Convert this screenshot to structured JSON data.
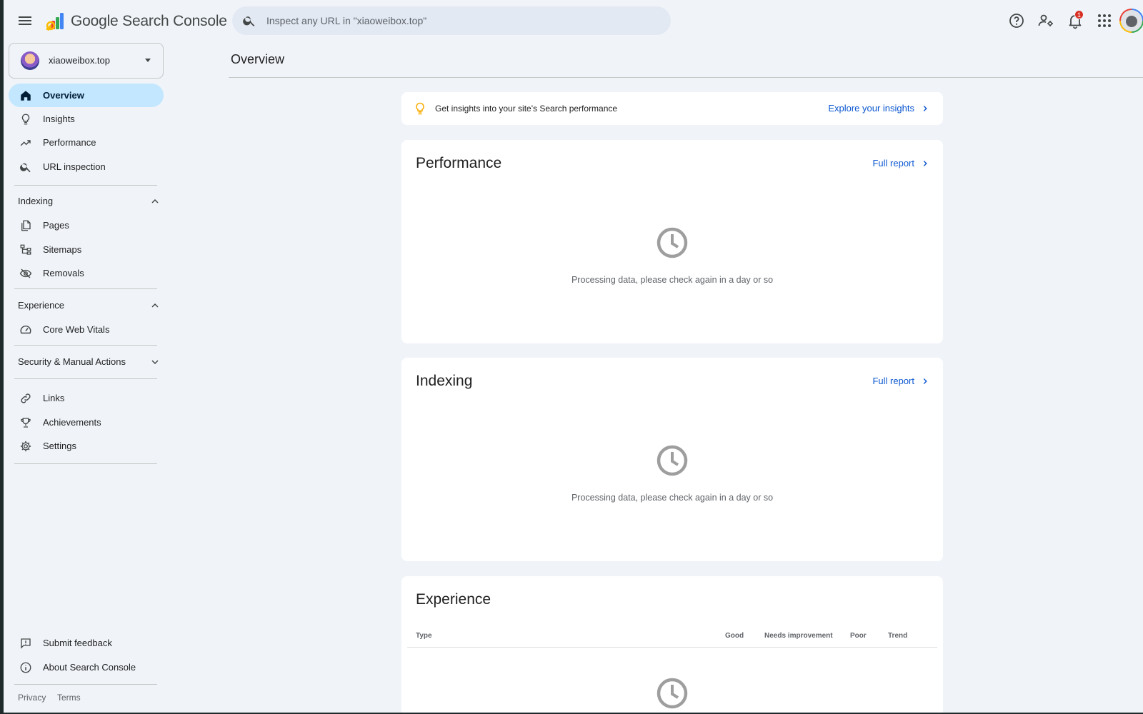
{
  "app": {
    "name": "Google Search Console",
    "search_placeholder": "Inspect any URL in \"xiaoweibox.top\"",
    "notification_count": "1"
  },
  "property": {
    "name": "xiaoweibox.top"
  },
  "sidebar": {
    "top_items": [
      {
        "label": "Overview",
        "icon": "home-icon",
        "active": true
      },
      {
        "label": "Insights",
        "icon": "lightbulb-icon"
      },
      {
        "label": "Performance",
        "icon": "trending-up-icon"
      },
      {
        "label": "URL inspection",
        "icon": "search-icon"
      }
    ],
    "indexing": {
      "label": "Indexing",
      "items": [
        {
          "label": "Pages",
          "icon": "pages-icon"
        },
        {
          "label": "Sitemaps",
          "icon": "sitemap-icon"
        },
        {
          "label": "Removals",
          "icon": "visibility-off-icon"
        }
      ]
    },
    "experience": {
      "label": "Experience",
      "items": [
        {
          "label": "Core Web Vitals",
          "icon": "speed-icon"
        }
      ]
    },
    "security": {
      "label": "Security & Manual Actions"
    },
    "bottom_items": [
      {
        "label": "Links",
        "icon": "link-icon"
      },
      {
        "label": "Achievements",
        "icon": "trophy-icon"
      },
      {
        "label": "Settings",
        "icon": "gear-icon"
      }
    ],
    "footer_items": [
      {
        "label": "Submit feedback",
        "icon": "feedback-icon"
      },
      {
        "label": "About Search Console",
        "icon": "info-icon"
      }
    ],
    "legal": {
      "privacy": "Privacy",
      "terms": "Terms"
    }
  },
  "main": {
    "title": "Overview",
    "insight": {
      "text": "Get insights into your site's Search performance",
      "link": "Explore your insights"
    },
    "performance": {
      "title": "Performance",
      "link": "Full report",
      "status": "Processing data, please check again in a day or so"
    },
    "indexing": {
      "title": "Indexing",
      "link": "Full report",
      "status": "Processing data, please check again in a day or so"
    },
    "experience": {
      "title": "Experience",
      "columns": {
        "type": "Type",
        "good": "Good",
        "needs_improvement": "Needs improvement",
        "poor": "Poor",
        "trend": "Trend"
      }
    }
  },
  "colors": {
    "accent": "#0b57d0",
    "active_nav": "#c2e7ff",
    "background": "#f0f4f9"
  }
}
